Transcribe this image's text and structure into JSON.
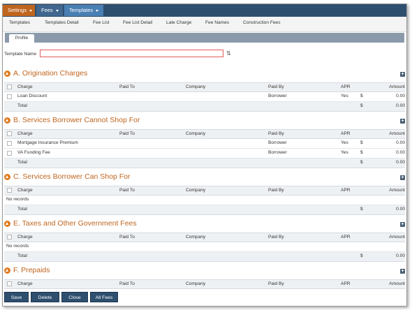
{
  "menu": {
    "settings": "Settings",
    "fees": "Fees",
    "templates": "Templates"
  },
  "subtabs": [
    "Templates",
    "Templates Detail",
    "Fee List",
    "Fee List Detail",
    "Late Charge",
    "Fee Names",
    "Construction Fees"
  ],
  "profile_tab": "Profile",
  "template_name": {
    "label": "Template Name",
    "value": ""
  },
  "columns": {
    "charge": "Charge",
    "paid_to": "Paid To",
    "company": "Company",
    "paid_by": "Paid By",
    "apr": "APR",
    "amount": "Amount"
  },
  "no_records": "No records",
  "total_label": "Total",
  "currency": "$",
  "sections": [
    {
      "title": "A. Origination Charges",
      "rows": [
        {
          "charge": "Loan Discount",
          "paid_by": "Borrower",
          "apr": "Yes",
          "amount": "0.00"
        }
      ],
      "total": "0.00"
    },
    {
      "title": "B. Services Borrower Cannot Shop For",
      "rows": [
        {
          "charge": "Mortgage Insurance Premium",
          "paid_by": "Borrower",
          "apr": "Yes",
          "amount": "0.00"
        },
        {
          "charge": "VA Funding Fee",
          "paid_by": "Borrower",
          "apr": "Yes",
          "amount": "0.00"
        }
      ],
      "total": "0.00"
    },
    {
      "title": "C. Services Borrower Can Shop For",
      "rows": [],
      "total": "0.00"
    },
    {
      "title": "E. Taxes and Other Government Fees",
      "rows": [],
      "total": "0.00"
    },
    {
      "title": "F. Prepaids",
      "rows": [],
      "total": ""
    }
  ],
  "buttons": {
    "save": "Save",
    "delete": "Delete",
    "close": "Close",
    "all_fees": "All Fees"
  },
  "colors": {
    "accent_orange": "#c0651e",
    "nav_dark": "#2f4f6f",
    "nav_light": "#4a7fb4",
    "input_error_border": "#e05b5b"
  }
}
